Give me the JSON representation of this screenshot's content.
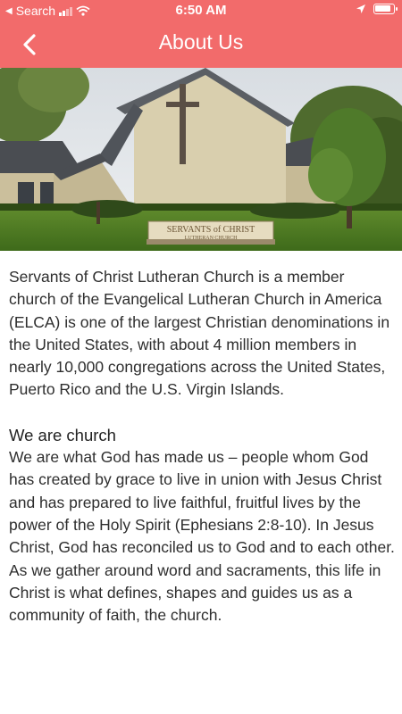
{
  "status_bar": {
    "back_app": "Search",
    "time": "6:50 AM"
  },
  "header": {
    "title": "About Us"
  },
  "hero": {
    "sign_text": "SERVANTS of CHRIST",
    "sign_subtext": "LUTHERAN CHURCH"
  },
  "content": {
    "intro": "Servants of Christ Lutheran Church is a member church of the Evangelical Lutheran Church in America (ELCA) is one of the largest Christian denominations in the United States, with about 4 million members in nearly 10,000 congregations across the United States, Puerto Rico and the U.S. Virgin Islands.",
    "section_heading": "We are church",
    "section_body": "We are what God has made us – people whom God has created by grace to live in union with Jesus Christ and has prepared to live faithful, fruitful lives by the power of the Holy Spirit (Ephesians 2:8-10). In Jesus Christ, God has reconciled us to God and to each other. As we gather around word and sacraments, this life in Christ is what defines, shapes and guides us as a community of faith, the church."
  },
  "colors": {
    "header_bg": "#f26b6b",
    "text": "#2e2e2e"
  }
}
